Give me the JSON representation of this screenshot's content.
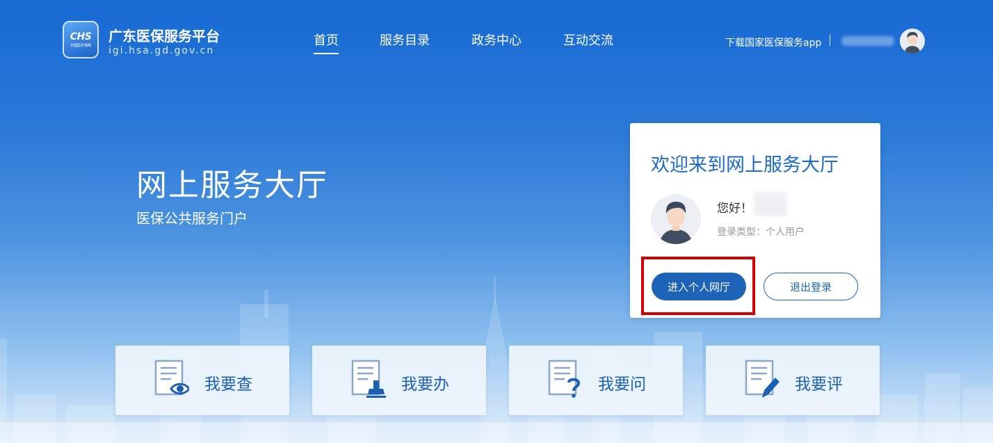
{
  "header": {
    "logo_text": "CHS",
    "logo_subtext": "中国医疗保障",
    "site_title": "广东医保服务平台",
    "site_url": "igi.hsa.gd.gov.cn",
    "nav": [
      {
        "label": "首页",
        "active": true
      },
      {
        "label": "服务目录",
        "active": false
      },
      {
        "label": "政务中心",
        "active": false
      },
      {
        "label": "互动交流",
        "active": false
      }
    ],
    "download_link": "下载国家医保服务app"
  },
  "hero": {
    "title": "网上服务大厅",
    "subtitle": "医保公共服务门户"
  },
  "login_card": {
    "title": "欢迎来到网上服务大厅",
    "greeting": "您好！",
    "login_type": "登录类型：个人用户",
    "enter_button": "进入个人网厅",
    "logout_button": "退出登录"
  },
  "services": [
    {
      "label": "我要查",
      "icon": "eye-icon"
    },
    {
      "label": "我要办",
      "icon": "stamp-icon"
    },
    {
      "label": "我要问",
      "icon": "question-icon"
    },
    {
      "label": "我要评",
      "icon": "pen-icon"
    }
  ],
  "colors": {
    "primary": "#1d63b7",
    "highlight": "#d40000",
    "title_blue": "#1d6bc4"
  }
}
